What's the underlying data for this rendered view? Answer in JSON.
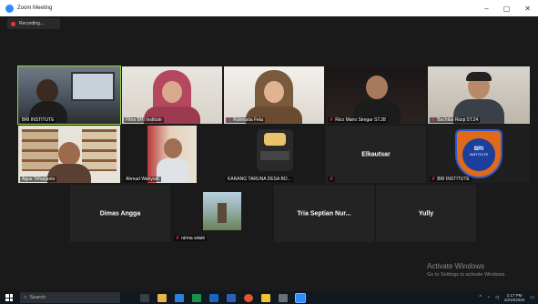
{
  "window": {
    "title": "Zoom Meeting",
    "minimize": "–",
    "maximize": "▢",
    "close": "✕"
  },
  "recording": {
    "label": "Recording..."
  },
  "participants": {
    "row1": [
      {
        "name": "BRI INSTITUTE",
        "muted": false,
        "active": true
      },
      {
        "name": "Fitria BRI Institute",
        "muted": false
      },
      {
        "name": "Rahmatia Feta",
        "muted": true
      },
      {
        "name": "Rico Mario Siregar ST.28",
        "muted": true
      },
      {
        "name": "Bachtiar Rizqi ST.24",
        "muted": true
      }
    ],
    "row2": [
      {
        "name": "Agus Triharjanto",
        "muted": false
      },
      {
        "name": "Ahmad Wahyudi",
        "muted": false
      },
      {
        "name": "KARANG TARUNA DESA BO...",
        "muted": false
      },
      {
        "name": "Elkautsar",
        "muted": true,
        "audio_only": true
      },
      {
        "name": "BRI INSTITUTE",
        "muted": true
      }
    ],
    "row3": [
      {
        "name": "Dimas Angga",
        "audio_only": true
      },
      {
        "name": "nirma wiwin",
        "muted": true
      },
      {
        "name": "Tria Septian Nur...",
        "audio_only": true
      },
      {
        "name": "Yully",
        "audio_only": true
      }
    ]
  },
  "tile_text": {
    "bri_logo_top": "BRI",
    "bri_logo_bottom": "INSTITUTE"
  },
  "watermark": {
    "line1": "Activate Windows",
    "line2": "Go to Settings to activate Windows."
  },
  "taskbar": {
    "search_placeholder": "Search",
    "time": "1:17 PM",
    "date": "10/10/2020"
  },
  "colors": {
    "active_speaker": "#9bd23a",
    "mute": "#e33333",
    "zoom_blue": "#2D8CFF"
  }
}
